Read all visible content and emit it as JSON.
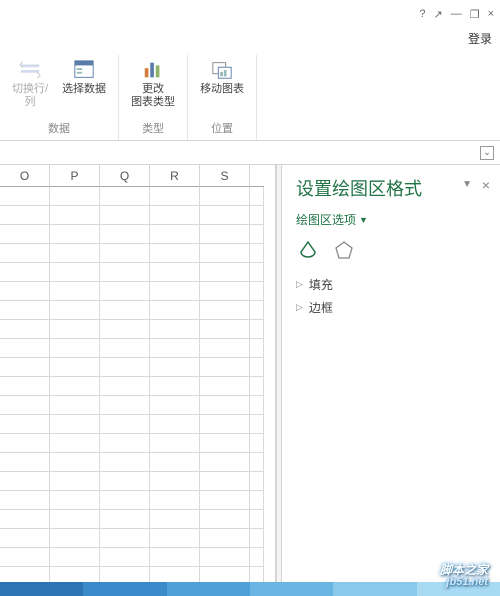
{
  "titlebar": {
    "help": "?",
    "ro": "↗",
    "min": "—",
    "max": "❐",
    "close": "×"
  },
  "login": "登录",
  "ribbon": {
    "g1": {
      "switch": "切换行/列",
      "select": "选择数据",
      "group": "数据"
    },
    "g2": {
      "change": "更改\n图表类型",
      "group": "类型"
    },
    "g3": {
      "move": "移动图表",
      "group": "位置"
    }
  },
  "cols": [
    "O",
    "P",
    "Q",
    "R",
    "S"
  ],
  "pane": {
    "title": "设置绘图区格式",
    "selector": "绘图区选项",
    "fill": "填充",
    "border": "边框"
  },
  "watermark": {
    "brand": "脚本之家",
    "url": "jb51.net"
  }
}
